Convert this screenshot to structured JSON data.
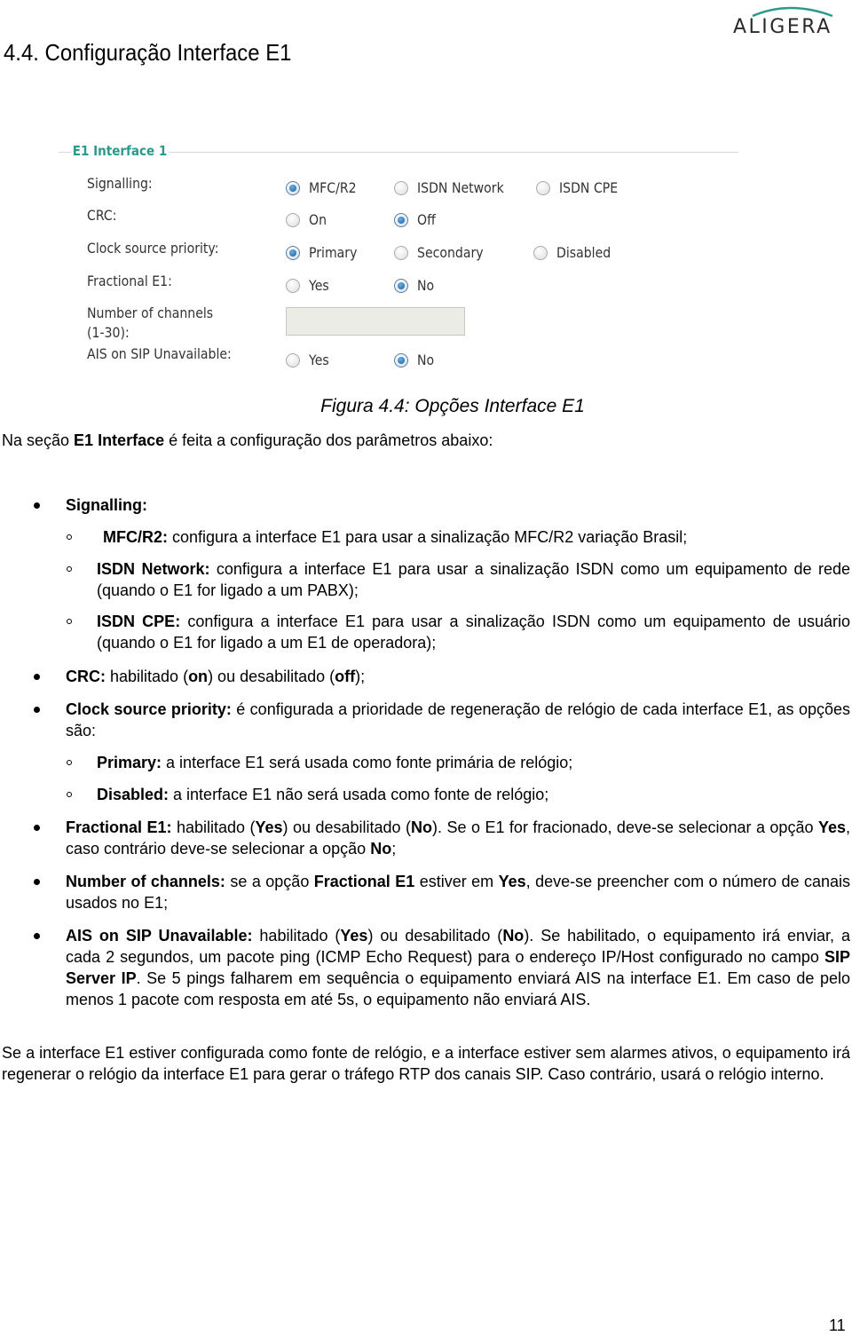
{
  "header": {
    "logo_text": "ALIGERA",
    "logo_arc_color": "#2a9a8a",
    "section_title": "4.4. Configuração Interface E1"
  },
  "figure": {
    "legend": "E1 Interface 1",
    "accent_color": "#2a9a8a",
    "rows": {
      "signalling": {
        "label": "Signalling:",
        "options": [
          {
            "label": "MFC/R2",
            "checked": true
          },
          {
            "label": "ISDN Network",
            "checked": false
          },
          {
            "label": "ISDN CPE",
            "checked": false
          }
        ]
      },
      "crc": {
        "label": "CRC:",
        "options": [
          {
            "label": "On",
            "checked": false
          },
          {
            "label": "Off",
            "checked": true
          }
        ]
      },
      "clock": {
        "label": "Clock source priority:",
        "options": [
          {
            "label": "Primary",
            "checked": true
          },
          {
            "label": "Secondary",
            "checked": false
          },
          {
            "label": "Disabled",
            "checked": false
          }
        ]
      },
      "fractional": {
        "label": "Fractional E1:",
        "options": [
          {
            "label": "Yes",
            "checked": false
          },
          {
            "label": "No",
            "checked": true
          }
        ]
      },
      "channels": {
        "label_line1": "Number of channels",
        "label_line2": "(1-30):",
        "value": ""
      },
      "ais": {
        "label": "AIS on SIP Unavailable:",
        "options": [
          {
            "label": "Yes",
            "checked": false
          },
          {
            "label": "No",
            "checked": true
          }
        ]
      }
    },
    "caption": "Figura 4.4: Opções Interface E1"
  },
  "body": {
    "intro": {
      "pre": "Na seção ",
      "bold": "E1 Interface",
      "post": " é feita a configuração dos parâmetros abaixo:"
    },
    "signalling": {
      "title": "Signalling:",
      "items": [
        {
          "term": "MFC/R2:",
          "text": " configura a interface E1 para usar a sinalização MFC/R2 variação Brasil;"
        },
        {
          "term": "ISDN Network:",
          "text": " configura a interface E1 para usar a sinalização ISDN como um equipamento de rede (quando o E1 for ligado a um PABX);"
        },
        {
          "term": "ISDN CPE:",
          "text": " configura a interface E1 para usar a sinalização ISDN como um equipamento de usuário (quando o E1 for ligado a um E1 de operadora);"
        }
      ]
    },
    "crc": {
      "term": "CRC:",
      "t1": " habilitado (",
      "b1": "on",
      "t2": ") ou desabilitado (",
      "b2": "off",
      "t3": ");"
    },
    "clock": {
      "term": "Clock source priority:",
      "text": " é configurada a prioridade de regeneração de relógio de cada interface E1, as opções são:",
      "items": [
        {
          "term": "Primary:",
          "text": " a interface E1 será usada como fonte primária de relógio;"
        },
        {
          "term": "Disabled:",
          "text": " a interface E1 não será usada como fonte de relógio;"
        }
      ]
    },
    "fractional": {
      "term": "Fractional E1:",
      "t1": " habilitado (",
      "b1": "Yes",
      "t2": ") ou desabilitado (",
      "b2": "No",
      "t3": "). Se o E1 for fracionado, deve-se selecionar a opção ",
      "b3": "Yes",
      "t4": ", caso contrário deve-se selecionar a opção ",
      "b4": "No",
      "t5": ";"
    },
    "channels": {
      "term": "Number of channels:",
      "t1": " se a opção ",
      "b1": "Fractional E1",
      "t2": " estiver em ",
      "b2": "Yes",
      "t3": ", deve-se preencher com o número de canais usados no E1;"
    },
    "ais": {
      "term": "AIS on SIP Unavailable:",
      "t1": " habilitado (",
      "b1": "Yes",
      "t2": ") ou desabilitado (",
      "b2": "No",
      "t3": "). Se habilitado, o equipamento irá enviar, a cada 2 segundos, um pacote ping (ICMP Echo Request) para o endereço IP/Host configurado no campo ",
      "b3": "SIP Server IP",
      "t4": ". Se 5 pings falharem em sequência o equipamento enviará AIS na interface E1. Em caso de pelo menos 1 pacote com resposta em até 5s, o equipamento não enviará AIS."
    },
    "closing": "Se a interface E1 estiver configurada como fonte de relógio, e a interface estiver sem alarmes ativos, o equipamento irá regenerar o relógio da interface E1 para gerar o tráfego RTP dos canais SIP. Caso contrário, usará o relógio interno."
  },
  "footer": {
    "page_number": "11"
  }
}
